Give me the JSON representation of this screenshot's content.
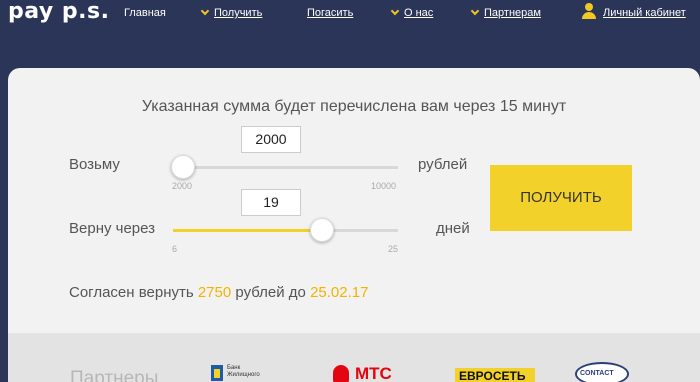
{
  "header": {
    "logo": "pay p.s.",
    "nav": {
      "home": "Главная",
      "get": "Получить",
      "repay": "Погасить",
      "about": "О нас",
      "partners": "Партнерам",
      "account": "Личный кабинет"
    }
  },
  "calc": {
    "title": "Указанная сумма будет перечислена вам через 15 минут",
    "take_label": "Возьму",
    "take_unit": "рублей",
    "amount": "2000",
    "amount_min": "2000",
    "amount_max": "10000",
    "amount_fraction": 0.0,
    "return_label": "Верну через",
    "return_unit": "дней",
    "days": "19",
    "days_min": "6",
    "days_max": "25",
    "days_fraction": 0.684,
    "submit": "ПОЛУЧИТЬ",
    "agree_prefix": "Согласен вернуть",
    "agree_amount": "2750",
    "agree_middle": "рублей до",
    "agree_date": "25.02.17"
  },
  "partners": {
    "title": "Партнеры",
    "bank_line1": "Банк",
    "bank_line2": "Жилищного",
    "mts": "МТС",
    "euroset": "ЕВРОСЕТЬ",
    "contact": "CONTACT"
  },
  "colors": {
    "header_bg": "#2b3557",
    "accent": "#f2d22a",
    "highlight": "#f0b400",
    "mts_red": "#e30611"
  }
}
